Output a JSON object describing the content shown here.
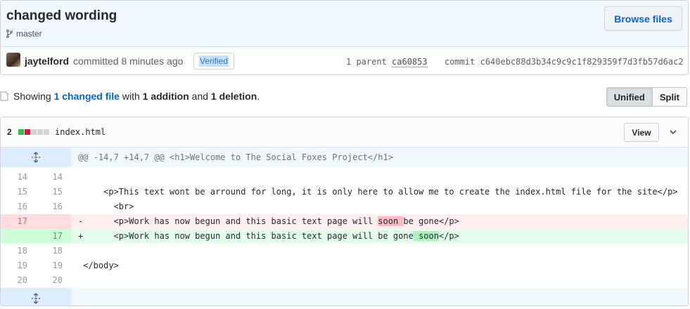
{
  "commit": {
    "title": "changed wording",
    "branch": "master",
    "browse_label": "Browse files",
    "author": "jaytelford",
    "committed_text": "committed 8 minutes ago",
    "verified_label": "Verified",
    "parent_prefix": "1 parent",
    "parent_sha": "ca60853",
    "commit_prefix": "commit",
    "commit_sha": "c640ebc88d3b34c9c9c1f829359f7d3fb57d6ac2"
  },
  "toolbar": {
    "showing_prefix": "Showing",
    "changed_files": "1 changed file",
    "with_text": "with",
    "additions": "1 addition",
    "and_text": "and",
    "deletions": "1 deletion",
    "period": ".",
    "unified_label": "Unified",
    "split_label": "Split"
  },
  "file": {
    "change_count": "2",
    "name": "index.html",
    "view_label": "View",
    "diffstat_colors": [
      "#2cbe4e",
      "#cb2431",
      "#d1d5da",
      "#d1d5da",
      "#d1d5da"
    ]
  },
  "diff": {
    "hunk_header": "@@ -14,7 +14,7 @@ <h1>Welcome to The Social Foxes Project</h1>",
    "lines": [
      {
        "type": "ctx",
        "old": "14",
        "new": "14",
        "sign": " ",
        "text": ""
      },
      {
        "type": "ctx",
        "old": "15",
        "new": "15",
        "sign": " ",
        "text": "    <p>This text wont be arround for long, it is only here to allow me to create the index.html file for the site</p>"
      },
      {
        "type": "ctx",
        "old": "16",
        "new": "16",
        "sign": " ",
        "text": "      <br>"
      },
      {
        "type": "del",
        "old": "17",
        "new": "",
        "sign": "-",
        "pre": "      <p>Work has now begun and this basic text page will ",
        "hl": "soon ",
        "post": "be gone</p>"
      },
      {
        "type": "add",
        "old": "",
        "new": "17",
        "sign": "+",
        "pre": "      <p>Work has now begun and this basic text page will be gone",
        "hl": " soon",
        "post": "</p>"
      },
      {
        "type": "ctx",
        "old": "18",
        "new": "18",
        "sign": " ",
        "text": ""
      },
      {
        "type": "ctx",
        "old": "19",
        "new": "19",
        "sign": " ",
        "text": "</body>"
      },
      {
        "type": "ctx",
        "old": "20",
        "new": "20",
        "sign": " ",
        "text": ""
      }
    ]
  }
}
